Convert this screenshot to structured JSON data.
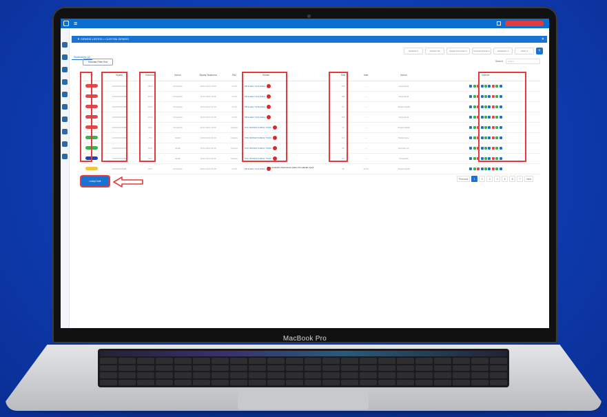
{
  "device": {
    "brand": "MacBook Pro"
  },
  "breadcrumb": "▼ SIPARIS LISTESI > CUSTOM SIPARIS",
  "tabs": [
    "Siparişlerim (2)"
  ],
  "toolbar": {
    "buttons": [
      "Sütunlar ▾",
      "Filtreleri Sil",
      "Sipariş Durumları ▾",
      "E-Fatura Durumu",
      "Hareketler ▾",
      "Yazdır ▾"
    ],
    "add": "+"
  },
  "action_button": "Sütunlar Filtre Sıra",
  "search": {
    "label": "Search:",
    "placeholder": "Arama"
  },
  "columns": [
    "ST",
    "Sipariş",
    "Tutar/Ürün",
    "Durum",
    "Sipariş Oluşturma",
    "PAZ",
    "Ürünler",
    "",
    "Stok",
    "Adet",
    "Durum",
    "İşlemler"
  ],
  "rows": [
    {
      "status_color": "#e2474b",
      "siparis": "1234-000-0001",
      "tutar": "189,9",
      "durum": "Onaylandı",
      "tarih": "12.02.2021 13:00",
      "paz": "12.03",
      "urun": "Minimalist Tunik Elbise",
      "stok": "246",
      "adet": "—",
      "not": "Kargolandı"
    },
    {
      "status_color": "#e2474b",
      "siparis": "1234-000-0002",
      "tutar": "249,9",
      "durum": "Onaylandı",
      "tarih": "12.02.2021 13:05",
      "paz": "12.03",
      "urun": "Minimalist Tunik Elbise",
      "stok": "188",
      "adet": "—",
      "not": "Kargolandı"
    },
    {
      "status_color": "#e2474b",
      "siparis": "1234-000-0003",
      "tutar": "129,9",
      "durum": "Onaylandı",
      "tarih": "12.02.2021 13:10",
      "paz": "12.03",
      "urun": "Minimalist Tunik Elbise",
      "stok": "57",
      "adet": "—",
      "not": "Tedarik Edildi"
    },
    {
      "status_color": "#e2474b",
      "siparis": "1234-000-0004",
      "tutar": "179,9",
      "durum": "Onaylandı",
      "tarih": "12.02.2021 13:15",
      "paz": "12.03",
      "urun": "Minimalist Tunik Elbise",
      "stok": "148",
      "adet": "—",
      "not": "Kargolandı"
    },
    {
      "status_color": "#e2474b",
      "siparis": "1234-000-0005",
      "tutar": "99,9",
      "durum": "Onaylandı",
      "tarih": "12.02.2021 13:20",
      "paz": "Kapıda",
      "urun": "POLYESTER KUMAŞ TUNİK",
      "stok": "47",
      "adet": "—",
      "not": "Tedarik Edildi"
    },
    {
      "status_color": "#3cb04a",
      "siparis": "1234-000-0006",
      "tutar": "79,9",
      "durum": "İletildi",
      "tarih": "13.02.2021 09:10",
      "paz": "Kapıda",
      "urun": "POLYESTER KUMAŞ TUNİK",
      "stok": "110",
      "adet": "—",
      "not": "Beklemede"
    },
    {
      "status_color": "#3cb04a",
      "siparis": "1234-000-0007",
      "tutar": "89,9",
      "durum": "İletildi",
      "tarih": "13.02.2021 09:15",
      "paz": "Kapıda",
      "urun": "POLYESTER KUMAŞ TUNİK",
      "stok": "96",
      "adet": "—",
      "not": "Hazırlanıyor"
    },
    {
      "status_color": "#1f3fb8",
      "siparis": "1234-000-0008",
      "tutar": "59,9",
      "durum": "İletildi",
      "tarih": "13.02.2021 09:20",
      "paz": "Kapıda",
      "urun": "POLYESTER KUMAŞ TUNİK",
      "stok": "62",
      "adet": "—",
      "not": "Onaylandı"
    },
    {
      "status_color": "#f2c53d",
      "siparis": "1234-000-0009",
      "tutar": "69,9",
      "durum": "Onaylandı",
      "tarih": "13.02.2021 09:25",
      "paz": "12.03",
      "urun": "Minimalist Tunik Elbise",
      "stok": "38",
      "adet": "12.02",
      "not": "Tedarik Edildi"
    }
  ],
  "action_icon_colors": [
    "#1a73d3",
    "#3cb04a",
    "#e2474b",
    "#1a73d3",
    "#3cb04a",
    "#1a73d3",
    "#e2474b",
    "#3cb04a",
    "#1a73d3"
  ],
  "legend": "Bilgi amaçlıdır ölçek Excel çıktısı tüm alanları içerir",
  "export_button": "Listeyi İndir",
  "pagination": {
    "prev": "Previous",
    "pages": [
      "1",
      "2",
      "3",
      "4",
      "5",
      "6",
      "7"
    ],
    "active": "1",
    "next": "Next"
  }
}
